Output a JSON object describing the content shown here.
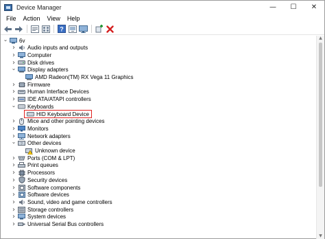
{
  "window": {
    "title": "Device Manager"
  },
  "caption": {
    "minimize": "—",
    "maximize": "☐",
    "close": "✕"
  },
  "menubar": {
    "items": [
      "File",
      "Action",
      "View",
      "Help"
    ]
  },
  "toolbar": {
    "buttons": [
      "back-icon",
      "forward-icon",
      "properties-icon",
      "device-grid-icon",
      "help-icon",
      "scan-hardware-icon",
      "monitor-icon",
      "add-driver-icon",
      "uninstall-icon"
    ]
  },
  "tree": {
    "root": "6v",
    "categories": [
      {
        "label": "Audio inputs and outputs",
        "icon": "speaker-icon",
        "expanded": false
      },
      {
        "label": "Computer",
        "icon": "computer-icon",
        "expanded": false
      },
      {
        "label": "Disk drives",
        "icon": "disk-icon",
        "expanded": false
      },
      {
        "label": "Display adapters",
        "icon": "display-adapter-icon",
        "expanded": true,
        "children": [
          "AMD Radeon(TM) RX Vega 11 Graphics"
        ]
      },
      {
        "label": "Firmware",
        "icon": "firmware-icon",
        "expanded": false
      },
      {
        "label": "Human Interface Devices",
        "icon": "hid-icon",
        "expanded": false
      },
      {
        "label": "IDE ATA/ATAPI controllers",
        "icon": "ide-icon",
        "expanded": false
      },
      {
        "label": "Keyboards",
        "icon": "keyboard-icon",
        "expanded": true,
        "children": [
          "HID Keyboard Device"
        ]
      },
      {
        "label": "Mice and other pointing devices",
        "icon": "mouse-icon",
        "expanded": false
      },
      {
        "label": "Monitors",
        "icon": "monitor-icon",
        "expanded": false
      },
      {
        "label": "Network adapters",
        "icon": "network-icon",
        "expanded": false
      },
      {
        "label": "Other devices",
        "icon": "other-devices-icon",
        "expanded": true,
        "children": [
          "Unknown device"
        ]
      },
      {
        "label": "Ports (COM & LPT)",
        "icon": "port-icon",
        "expanded": false
      },
      {
        "label": "Print queues",
        "icon": "printer-icon",
        "expanded": false
      },
      {
        "label": "Processors",
        "icon": "processor-icon",
        "expanded": false
      },
      {
        "label": "Security devices",
        "icon": "security-icon",
        "expanded": false
      },
      {
        "label": "Software components",
        "icon": "software-component-icon",
        "expanded": false
      },
      {
        "label": "Software devices",
        "icon": "software-device-icon",
        "expanded": false
      },
      {
        "label": "Sound, video and game controllers",
        "icon": "sound-icon",
        "expanded": false
      },
      {
        "label": "Storage controllers",
        "icon": "storage-icon",
        "expanded": false
      },
      {
        "label": "System devices",
        "icon": "system-icon",
        "expanded": false
      },
      {
        "label": "Universal Serial Bus controllers",
        "icon": "usb-icon",
        "expanded": false
      }
    ],
    "selected": "HID Keyboard Device"
  },
  "colors": {
    "highlight_border": "#e0201e",
    "uninstall_red": "#d42020",
    "add_green": "#2a9a3a"
  }
}
